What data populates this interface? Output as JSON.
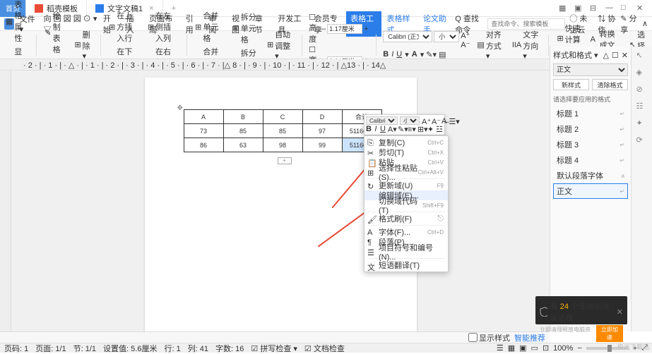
{
  "titlebar": {
    "home": "首页",
    "tab1": "稻壳模板",
    "tab2": "文字文稿1",
    "add": "+",
    "icons": [
      "grid",
      "box",
      "min",
      "max",
      "close"
    ]
  },
  "menubar": {
    "file": "文件",
    "items": [
      "开始",
      "插入",
      "页面布局",
      "引用",
      "审阅",
      "视图",
      "章节",
      "开发工具",
      "会员专享",
      "表格工具",
      "表格样式",
      "论文助手"
    ],
    "active": 9,
    "search_placeholder": "查找命令、搜索模板",
    "find": "Q 查找命令",
    "right": [
      "◯ 未上云",
      "⇅ 协作",
      "✎ 分享",
      "∧"
    ]
  },
  "ribbon": {
    "g1": [
      "表格属性",
      "显示选择"
    ],
    "g2": [
      "绘制表格",
      "擦除"
    ],
    "g3": "删除 ▾",
    "g4": [
      "在上方插入行",
      "在下方插入行"
    ],
    "g5": [
      "在左侧插入列",
      "在右侧插入列"
    ],
    "g6": [
      "合并单元格",
      "合并单元格 ▾"
    ],
    "g7": [
      "拆分单元格",
      "拆分表格 ▾"
    ],
    "g8": "自动调整 ▾",
    "height_lbl": "高度",
    "height_val": "1.17厘米",
    "width_lbl": "宽度",
    "width_val": "3.01厘米",
    "font": "Calibri (正文)",
    "size": "小四",
    "quick": "快速计算 ▾",
    "formula": "fx 公式",
    "convert": "转换成文本",
    "select": "选择 ▾",
    "align": "对齐方式 ▾",
    "dir": "文字方向 ▾"
  },
  "table": {
    "headers": [
      "A",
      "B",
      "C",
      "D",
      "合计"
    ],
    "rows": [
      [
        "73",
        "85",
        "85",
        "97",
        "5116022"
      ],
      [
        "86",
        "63",
        "98",
        "99",
        "5116022"
      ]
    ]
  },
  "mini": {
    "font": "Calibri (西",
    "size": "小四"
  },
  "ctx": {
    "copy": "复制(C)",
    "copy_sc": "Ctrl+C",
    "cut": "剪切(T)",
    "cut_sc": "Ctrl+X",
    "paste": "粘贴",
    "paste_sc": "Ctrl+V",
    "paste_sp": "选择性粘贴(S)...",
    "paste_sp_sc": "Ctrl+Alt+V",
    "update": "更新域(U)",
    "update_sc": "F9",
    "edit": "编辑域(E)...",
    "toggle": "切换域代码(T)",
    "toggle_sc": "Shift+F9",
    "format": "格式刷(F)",
    "font": "字体(F)...",
    "font_sc": "Ctrl+D",
    "para": "段落(P)...",
    "bullets": "项目符号和编号(N)...",
    "translate": "短语翻译(T)"
  },
  "panel": {
    "title": "样式和格式 ▾",
    "current": "正文",
    "btn_new": "新样式",
    "btn_clear": "清除格式",
    "prompt": "请选择要应用的格式",
    "styles": [
      "标题 1",
      "标题 2",
      "标题 3",
      "标题 4",
      "默认段落字体",
      "正文"
    ]
  },
  "bottombar": {
    "show": "显示样式",
    "smart": "智能推荐"
  },
  "toast": {
    "text1": "有",
    "num": "24",
    "text2": "个无用的残留进程",
    "sub": "立即清理释放电脑资源",
    "btn": "立即加速"
  },
  "status": {
    "page": "页码: 1",
    "pages": "页面: 1/1",
    "section": "节: 1/1",
    "pos": "设置值: 5.6厘米",
    "row": "行: 1",
    "col": "列: 41",
    "words": "字数: 16",
    "spell": "拼写检查 ▾",
    "doc": "文档检查",
    "zoom": "100%"
  },
  "watermark": "·极光下载站"
}
